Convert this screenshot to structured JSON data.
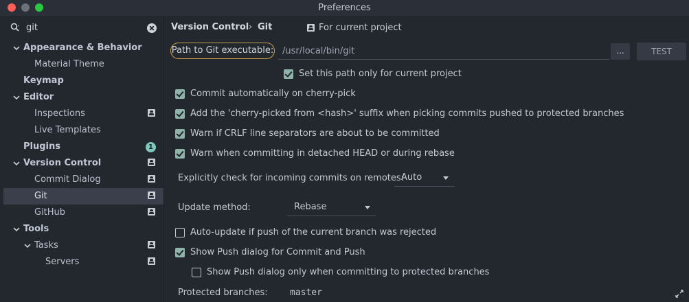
{
  "window": {
    "title": "Preferences"
  },
  "sidebar": {
    "search": {
      "value": "git",
      "icon": "search-icon"
    },
    "items": [
      {
        "label": "Appearance & Behavior",
        "bold": true,
        "expanded": true
      },
      {
        "label": "Material Theme",
        "bold": false
      },
      {
        "label": "Keymap",
        "bold": true
      },
      {
        "label": "Editor",
        "bold": true,
        "expanded": true
      },
      {
        "label": "Inspections",
        "bold": false,
        "project_icon": true
      },
      {
        "label": "Live Templates",
        "bold": false
      },
      {
        "label": "Plugins",
        "bold": true,
        "badge": "1"
      },
      {
        "label": "Version Control",
        "bold": true,
        "expanded": true,
        "project_icon": true
      },
      {
        "label": "Commit Dialog",
        "bold": false,
        "project_icon": true
      },
      {
        "label": "Git",
        "bold": false,
        "project_icon": true,
        "selected": true
      },
      {
        "label": "GitHub",
        "bold": false,
        "project_icon": true
      },
      {
        "label": "Tools",
        "bold": true,
        "expanded": true
      },
      {
        "label": "Tasks",
        "bold": false,
        "expanded": true,
        "project_icon": true
      },
      {
        "label": "Servers",
        "bold": false,
        "project_icon": true
      }
    ]
  },
  "main": {
    "breadcrumb": {
      "parent": "Version Control",
      "separator": "›",
      "current": "Git"
    },
    "scope": "For current project",
    "path_label": "Path to Git executable:",
    "path_value": "/usr/local/bin/git",
    "browse_label": "...",
    "test_label": "TEST",
    "set_path_only": {
      "label": "Set this path only for current project",
      "checked": true
    },
    "options": [
      {
        "label": "Commit automatically on cherry-pick",
        "checked": true
      },
      {
        "label": "Add the 'cherry-picked from <hash>' suffix when picking commits pushed to protected branches",
        "checked": true
      },
      {
        "label": "Warn if CRLF line separators are about to be committed",
        "checked": true
      },
      {
        "label": "Warn when committing in detached HEAD or during rebase",
        "checked": true
      }
    ],
    "incoming_label": "Explicitly check for incoming commits on remotes:",
    "incoming_value": "Auto",
    "update_label": "Update method:",
    "update_value": "Rebase",
    "auto_update": {
      "label": "Auto-update if push of the current branch was rejected",
      "checked": false
    },
    "show_push": {
      "label": "Show Push dialog for Commit and Push",
      "checked": true
    },
    "show_push_protected": {
      "label": "Show Push dialog only when committing to protected branches",
      "checked": false
    },
    "protected_label": "Protected branches:",
    "protected_value": "master"
  },
  "colors": {
    "accent": "#c9a04e",
    "checkbox": "#8fb3a9",
    "badge": "#7dc7bf",
    "selection": "#3a3f4b"
  }
}
